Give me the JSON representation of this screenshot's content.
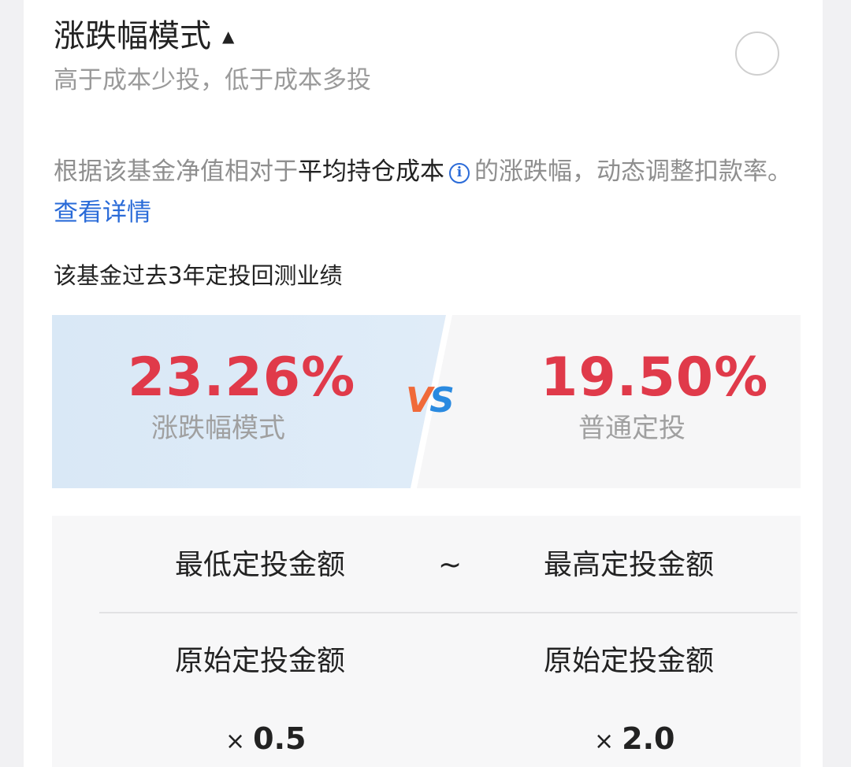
{
  "mode": {
    "title": "涨跌幅模式",
    "caret": "▲",
    "subtitle": "高于成本少投，低于成本多投",
    "selected": false
  },
  "description": {
    "part1": "根据该基金净值相对于",
    "highlight": "平均持仓成本",
    "info_icon": "i",
    "part2": "的涨跌幅，动态调整扣款率。",
    "link": "查看详情"
  },
  "backtest": {
    "title": "该基金过去3年定投回测业绩",
    "left": {
      "value": "23.26%",
      "label": "涨跌幅模式"
    },
    "vs": {
      "v": "V",
      "s": "S"
    },
    "right": {
      "value": "19.50%",
      "label": "普通定投"
    }
  },
  "amount_table": {
    "min_label": "最低定投金额",
    "separator": "~",
    "max_label": "最高定投金额",
    "base_left": "原始定投金额",
    "base_right": "原始定投金额",
    "times_symbol": "×",
    "min_multiplier": "0.5",
    "max_multiplier": "2.0"
  },
  "colors": {
    "accent_red": "#e03a4a",
    "link_blue": "#2a6bd8",
    "vs_orange": "#f06a3a",
    "vs_blue": "#2a8ae0"
  }
}
